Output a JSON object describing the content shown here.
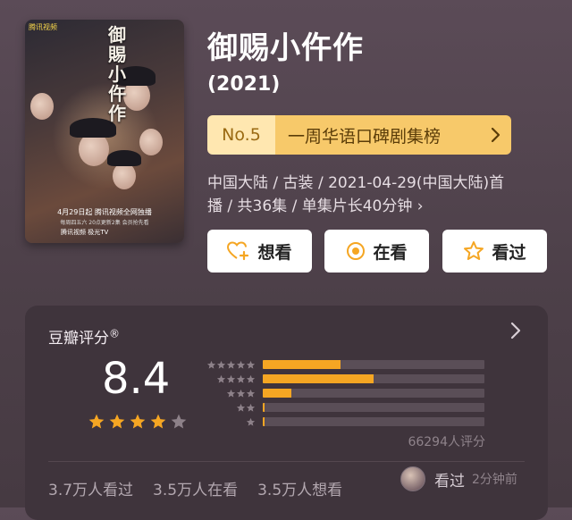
{
  "poster": {
    "title_chars": "御賜小仵作",
    "brand": "腾讯视频",
    "date_line": "4月29日起 腾讯视频全网独播",
    "sub_line": "每周四五六 20点更新2集 会员抢先看",
    "logos": "腾讯视频  极光TV"
  },
  "show": {
    "title": "御赐小仵作",
    "year": "(2021)",
    "rank_no": "No.5",
    "rank_name": "一周华语口碑剧集榜",
    "meta_line1": "中国大陆 / 古装 / 2021-04-29(中国大陆)首",
    "meta_line2": "播 / 共36集 / 单集片长40分钟",
    "meta_more": "›"
  },
  "actions": {
    "want": "想看",
    "watching": "在看",
    "watched": "看过"
  },
  "rating": {
    "label": "豆瓣评分",
    "reg": "®",
    "score": "8.4",
    "stars_full": 4,
    "stars_total": 5,
    "distribution": [
      {
        "stars": 5,
        "fraction": 0.35
      },
      {
        "stars": 4,
        "fraction": 0.5
      },
      {
        "stars": 3,
        "fraction": 0.13
      },
      {
        "stars": 2,
        "fraction": 0.01
      },
      {
        "stars": 1,
        "fraction": 0.005
      }
    ],
    "count": "66294人评分",
    "stats": {
      "watched": "3.7万人看过",
      "watching": "3.5万人在看",
      "want": "3.5万人想看"
    },
    "friend_action": "看过",
    "friend_time": "2分钟前"
  },
  "colors": {
    "accent": "#f5a623",
    "rank_bg": "#f7c96a",
    "rank_no_bg": "#ffe7b0"
  }
}
